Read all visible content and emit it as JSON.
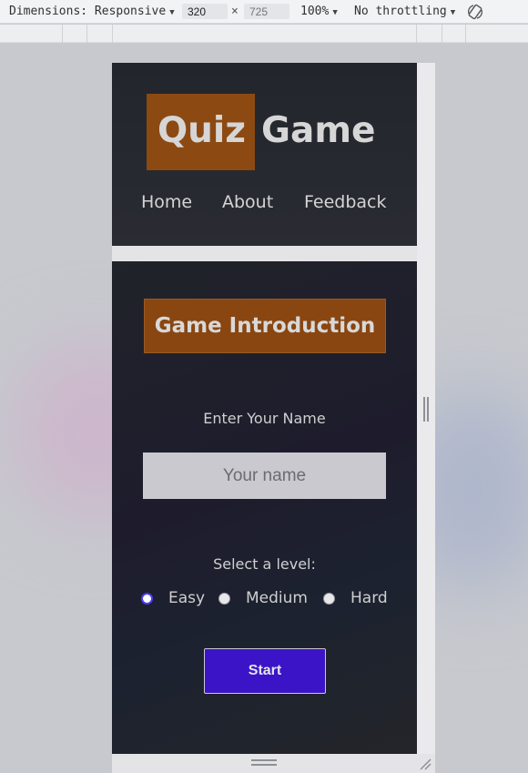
{
  "devtools": {
    "dimensions_label": "Dimensions: Responsive",
    "width_value": "320",
    "height_placeholder": "725",
    "times": "×",
    "zoom": "100%",
    "throttling": "No throttling",
    "rotate_icon": "rotate-icon"
  },
  "header": {
    "logo_word_1": "Quiz",
    "logo_word_2": "Game",
    "nav": [
      "Home",
      "About",
      "Feedback"
    ]
  },
  "main": {
    "intro_title": "Game Introduction",
    "name_label": "Enter Your Name",
    "name_placeholder": "Your name",
    "name_value": "",
    "level_label": "Select a level:",
    "levels": [
      {
        "label": "Easy",
        "checked": true
      },
      {
        "label": "Medium",
        "checked": false
      },
      {
        "label": "Hard",
        "checked": false
      }
    ],
    "start_label": "Start"
  },
  "colors": {
    "accent_orange": "#8c4a12",
    "start_button": "#3b14c7",
    "radio_checked": "#4b3cf0"
  }
}
